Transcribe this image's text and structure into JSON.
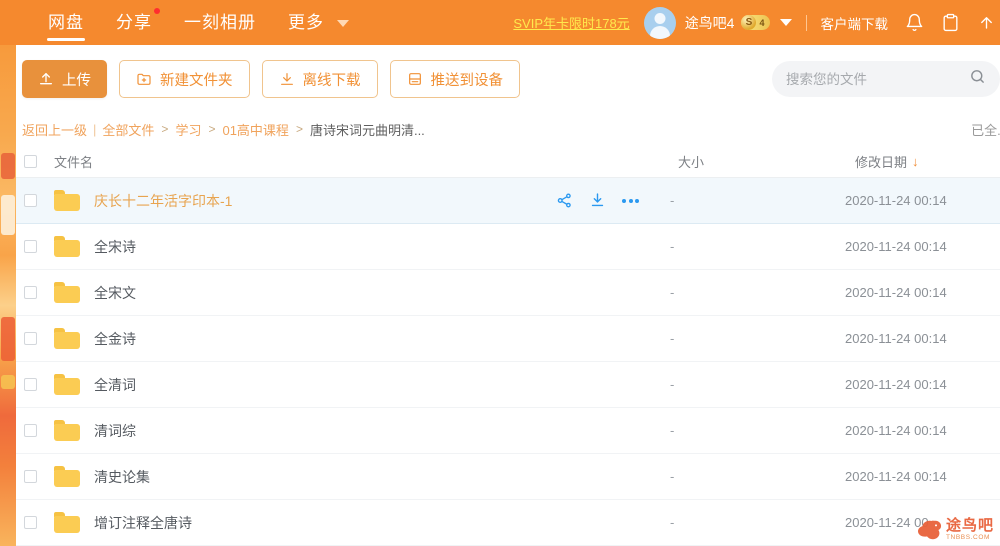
{
  "header": {
    "nav": [
      {
        "label": "网盘",
        "active": true,
        "dot": false,
        "caret": false
      },
      {
        "label": "分享",
        "active": false,
        "dot": true,
        "caret": false
      },
      {
        "label": "一刻相册",
        "active": false,
        "dot": false,
        "caret": false
      },
      {
        "label": "更多",
        "active": false,
        "dot": false,
        "caret": true
      }
    ],
    "svip_promo": "SVIP年卡限时178元",
    "username": "途鸟吧4",
    "vip_badge_letter": "S",
    "vip_badge_level": "4",
    "client_download": "客户端下载",
    "icons": [
      "bell-icon",
      "clipboard-icon",
      "upgrade-icon"
    ],
    "accent_color": "#f5892e"
  },
  "toolbar": {
    "upload_label": "上传",
    "new_folder_label": "新建文件夹",
    "offline_download_label": "离线下载",
    "push_device_label": "推送到设备",
    "upload_color": "#e8913c"
  },
  "search": {
    "placeholder": "搜索您的文件",
    "value": ""
  },
  "breadcrumb": {
    "back": "返回上一级",
    "separator": "|",
    "arrow": ">",
    "items": [
      "全部文件",
      "学习",
      "01高中课程"
    ],
    "current": "唐诗宋词元曲明清...",
    "right_text": "已全..."
  },
  "table": {
    "columns": {
      "name": "文件名",
      "size": "大小",
      "date": "修改日期",
      "sort_indicator": "↓"
    },
    "rows": [
      {
        "name": "庆长十二年活字印本-1",
        "size": "-",
        "date": "2020-11-24 00:14",
        "hover": true
      },
      {
        "name": "全宋诗",
        "size": "-",
        "date": "2020-11-24 00:14",
        "hover": false
      },
      {
        "name": "全宋文",
        "size": "-",
        "date": "2020-11-24 00:14",
        "hover": false
      },
      {
        "name": "全金诗",
        "size": "-",
        "date": "2020-11-24 00:14",
        "hover": false
      },
      {
        "name": "全清词",
        "size": "-",
        "date": "2020-11-24 00:14",
        "hover": false
      },
      {
        "name": "清词综",
        "size": "-",
        "date": "2020-11-24 00:14",
        "hover": false
      },
      {
        "name": "清史论集",
        "size": "-",
        "date": "2020-11-24 00:14",
        "hover": false
      },
      {
        "name": "增订注释全唐诗",
        "size": "-",
        "date": "2020-11-24 00",
        "hover": false
      }
    ],
    "row_actions": [
      "share-icon",
      "download-icon",
      "more-icon"
    ],
    "hover_color": "#f2f8fc",
    "action_color": "#2b99f0"
  },
  "watermark": {
    "cn": "途鸟吧",
    "en": "TNBBS.COM"
  }
}
